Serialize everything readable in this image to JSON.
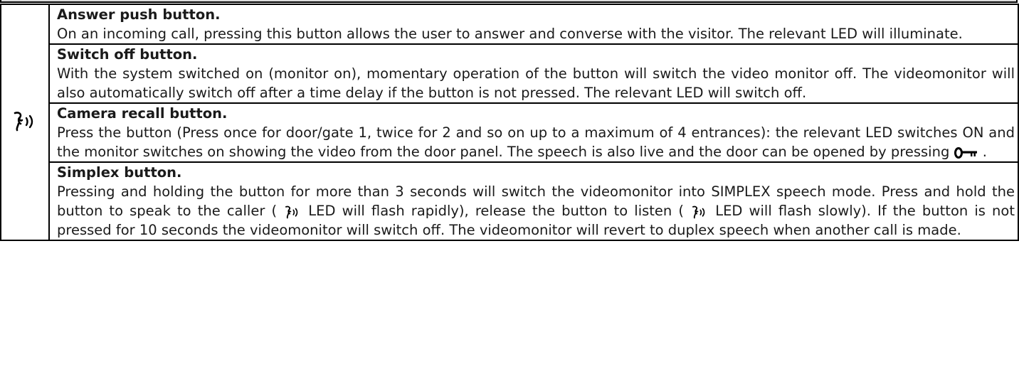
{
  "icon_column": {
    "icon": "speech-handset-icon"
  },
  "sections": [
    {
      "title": "Answer push button.",
      "body": "On an incoming call, pressing this button allows the user to answer and converse with the visitor. The relevant LED will illuminate."
    },
    {
      "title": "Switch off button.",
      "body": "With the system switched on (monitor on), momentary operation of the button will switch the video monitor off. The videomonitor will also automatically switch off after a time delay if the button is not pressed. The relevant LED will switch off."
    },
    {
      "title": "Camera recall button.",
      "body_pre": "Press the button (Press once for door/gate 1, twice for 2 and so on up to a maximum of 4 entrances): the relevant LED switches ON and the monitor switches on showing the video from the door panel. The speech is also live and the door can be opened by pressing",
      "body_post": " .",
      "inline_icon": "door-key-icon"
    },
    {
      "title": "Simplex button.",
      "body_1": "Pressing and holding the button for more than 3 seconds will switch the videomonitor into SIMPLEX speech mode. Press and hold the button to speak to the caller ( ",
      "body_2": " LED will flash rapidly), release the button to listen ( ",
      "body_3": " LED will flash slowly). If the button is not pressed for 10 seconds the videomonitor will switch off. The videomonitor will revert to duplex speech when another call is made.",
      "inline_icon": "speech-handset-icon"
    }
  ]
}
